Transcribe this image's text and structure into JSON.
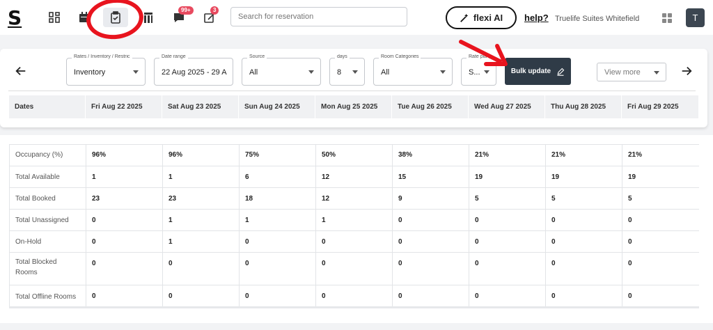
{
  "header": {
    "logo": "S",
    "badges": {
      "messages": "99+",
      "notes": "3"
    },
    "search_placeholder": "Search for reservation",
    "flexi_label": "flexi AI",
    "help_label": "help?",
    "hotel_name": "Truelife Suites Whitefield",
    "avatar_initial": "T"
  },
  "filters": {
    "rates": {
      "label": "Rates / Inventory / Restric",
      "value": "Inventory"
    },
    "date_range": {
      "label": "Date range",
      "value": "22 Aug 2025 - 29 A"
    },
    "source": {
      "label": "Source",
      "value": "All"
    },
    "days": {
      "label": "days",
      "value": "8"
    },
    "room_categories": {
      "label": "Room Categories",
      "value": "All"
    },
    "rate_plan": {
      "label": "Rate pla",
      "value": "S..."
    },
    "bulk_update_label": "Bulk update",
    "view_more_label": "View more"
  },
  "table": {
    "dates_header": "Dates",
    "dates": [
      "Fri Aug 22 2025",
      "Sat Aug 23 2025",
      "Sun Aug 24 2025",
      "Mon Aug 25 2025",
      "Tue Aug 26 2025",
      "Wed Aug 27 2025",
      "Thu Aug 28 2025",
      "Fri Aug 29 2025"
    ],
    "rows": [
      {
        "label": "Occupancy (%)",
        "values": [
          "96%",
          "96%",
          "75%",
          "50%",
          "38%",
          "21%",
          "21%",
          "21%"
        ]
      },
      {
        "label": "Total Available",
        "values": [
          "1",
          "1",
          "6",
          "12",
          "15",
          "19",
          "19",
          "19"
        ]
      },
      {
        "label": "Total Booked",
        "values": [
          "23",
          "23",
          "18",
          "12",
          "9",
          "5",
          "5",
          "5"
        ]
      },
      {
        "label": "Total Unassigned",
        "values": [
          "0",
          "1",
          "1",
          "1",
          "0",
          "0",
          "0",
          "0"
        ]
      },
      {
        "label": "On-Hold",
        "values": [
          "0",
          "1",
          "0",
          "0",
          "0",
          "0",
          "0",
          "0"
        ]
      },
      {
        "label": "Total Blocked Rooms",
        "values": [
          "0",
          "0",
          "0",
          "0",
          "0",
          "0",
          "0",
          "0"
        ]
      },
      {
        "label": "Total Offline Rooms",
        "values": [
          "0",
          "0",
          "0",
          "0",
          "0",
          "0",
          "0",
          "0"
        ]
      }
    ]
  },
  "colors": {
    "annotation_red": "#e8141e",
    "bulk_bg": "#2f3b47",
    "badge": "#e84a5f"
  }
}
